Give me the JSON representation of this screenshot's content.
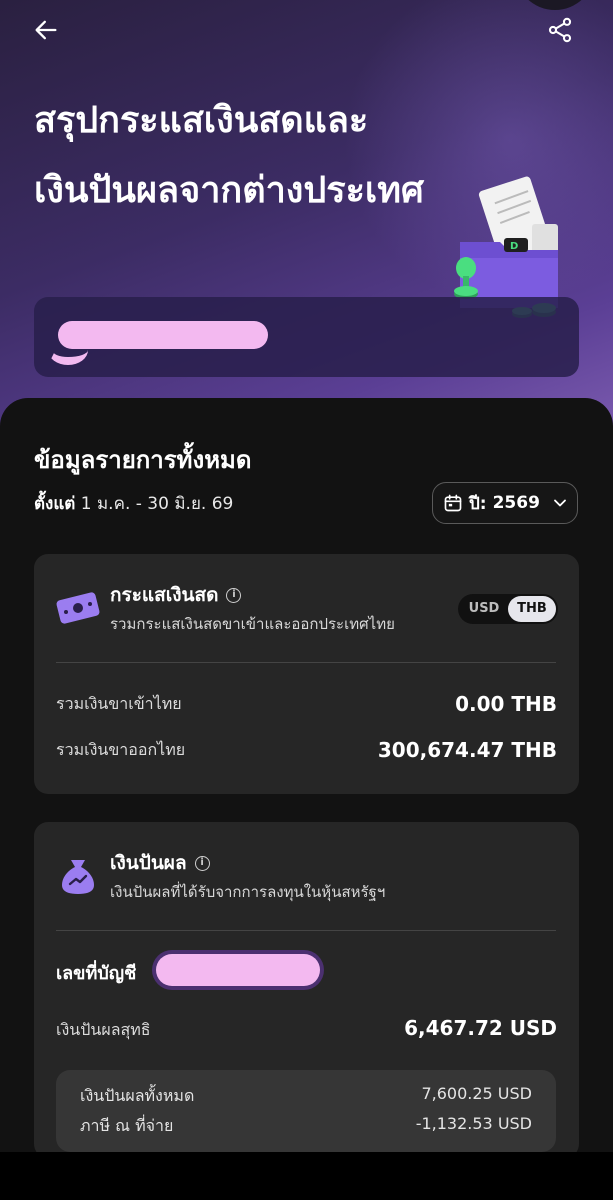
{
  "header": {
    "title": "สรุปกระแสเงินสดและเงินปันผลจากต่างประเทศ",
    "back_icon": "arrow-left-icon",
    "share_icon": "share-icon"
  },
  "summary": {
    "title": "ข้อมูลรายการทั้งหมด",
    "date_prefix": "ตั้งแต่",
    "date_range": " 1 ม.ค. - 30 มิ.ย. 69",
    "year_label": "ปี:",
    "year_value": "2569"
  },
  "cash_flow": {
    "title": "กระแสเงินสด",
    "subtitle": "รวมกระแสเงินสดขาเข้าและออกประเทศไทย",
    "currency_options": [
      "USD",
      "THB"
    ],
    "selected_currency": "THB",
    "inflow_label": "รวมเงินขาเข้าไทย",
    "inflow_value": "0.00 THB",
    "outflow_label": "รวมเงินขาออกไทย",
    "outflow_value": "300,674.47 THB"
  },
  "dividend": {
    "title": "เงินปันผล",
    "subtitle": "เงินปันผลที่ได้รับจากการลงทุนในหุ้นสหรัฐฯ",
    "account_label": "เลขที่บัญชี",
    "net_label": "เงินปันผลสุทธิ",
    "net_value": "6,467.72 USD",
    "total_label": "เงินปันผลทั้งหมด",
    "total_value": "7,600.25 USD",
    "tax_label": "ภาษี ณ ที่จ่าย",
    "tax_value": "-1,132.53 USD"
  },
  "colors": {
    "accent_purple": "#7c5ce0",
    "redaction": "#f3b9f0",
    "card_bg": "#262626"
  }
}
